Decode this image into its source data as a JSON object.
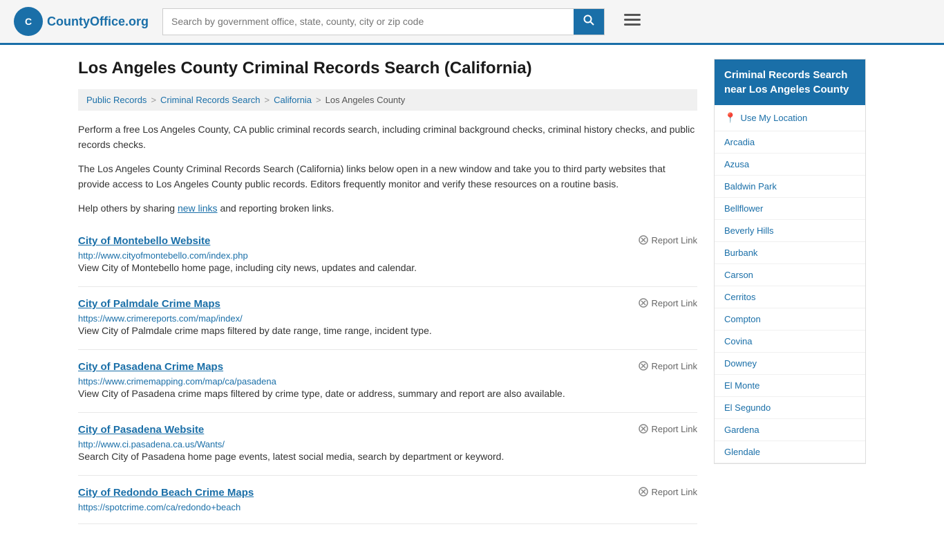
{
  "header": {
    "logo_text": "CountyOffice",
    "logo_tld": ".org",
    "search_placeholder": "Search by government office, state, county, city or zip code"
  },
  "page": {
    "title": "Los Angeles County Criminal Records Search (California)",
    "breadcrumbs": [
      {
        "label": "Public Records",
        "href": "#"
      },
      {
        "label": "Criminal Records Search",
        "href": "#"
      },
      {
        "label": "California",
        "href": "#"
      },
      {
        "label": "Los Angeles County",
        "href": "#"
      }
    ],
    "intro1": "Perform a free Los Angeles County, CA public criminal records search, including criminal background checks, criminal history checks, and public records checks.",
    "intro2": "The Los Angeles County Criminal Records Search (California) links below open in a new window and take you to third party websites that provide access to Los Angeles County public records. Editors frequently monitor and verify these resources on a routine basis.",
    "intro3_prefix": "Help others by sharing ",
    "intro3_link": "new links",
    "intro3_suffix": " and reporting broken links.",
    "results": [
      {
        "title": "City of Montebello Website",
        "url": "http://www.cityofmontebello.com/index.php",
        "desc": "View City of Montebello home page, including city news, updates and calendar.",
        "report": "Report Link"
      },
      {
        "title": "City of Palmdale Crime Maps",
        "url": "https://www.crimereports.com/map/index/",
        "desc": "View City of Palmdale crime maps filtered by date range, time range, incident type.",
        "report": "Report Link"
      },
      {
        "title": "City of Pasadena Crime Maps",
        "url": "https://www.crimemapping.com/map/ca/pasadena",
        "desc": "View City of Pasadena crime maps filtered by crime type, date or address, summary and report are also available.",
        "report": "Report Link"
      },
      {
        "title": "City of Pasadena Website",
        "url": "http://www.ci.pasadena.ca.us/Wants/",
        "desc": "Search City of Pasadena home page events, latest social media, search by department or keyword.",
        "report": "Report Link"
      },
      {
        "title": "City of Redondo Beach Crime Maps",
        "url": "https://spotcrime.com/ca/redondo+beach",
        "desc": "",
        "report": "Report Link"
      }
    ]
  },
  "sidebar": {
    "title": "Criminal Records Search near Los Angeles County",
    "use_location": "Use My Location",
    "cities": [
      "Arcadia",
      "Azusa",
      "Baldwin Park",
      "Bellflower",
      "Beverly Hills",
      "Burbank",
      "Carson",
      "Cerritos",
      "Compton",
      "Covina",
      "Downey",
      "El Monte",
      "El Segundo",
      "Gardena",
      "Glendale"
    ]
  }
}
